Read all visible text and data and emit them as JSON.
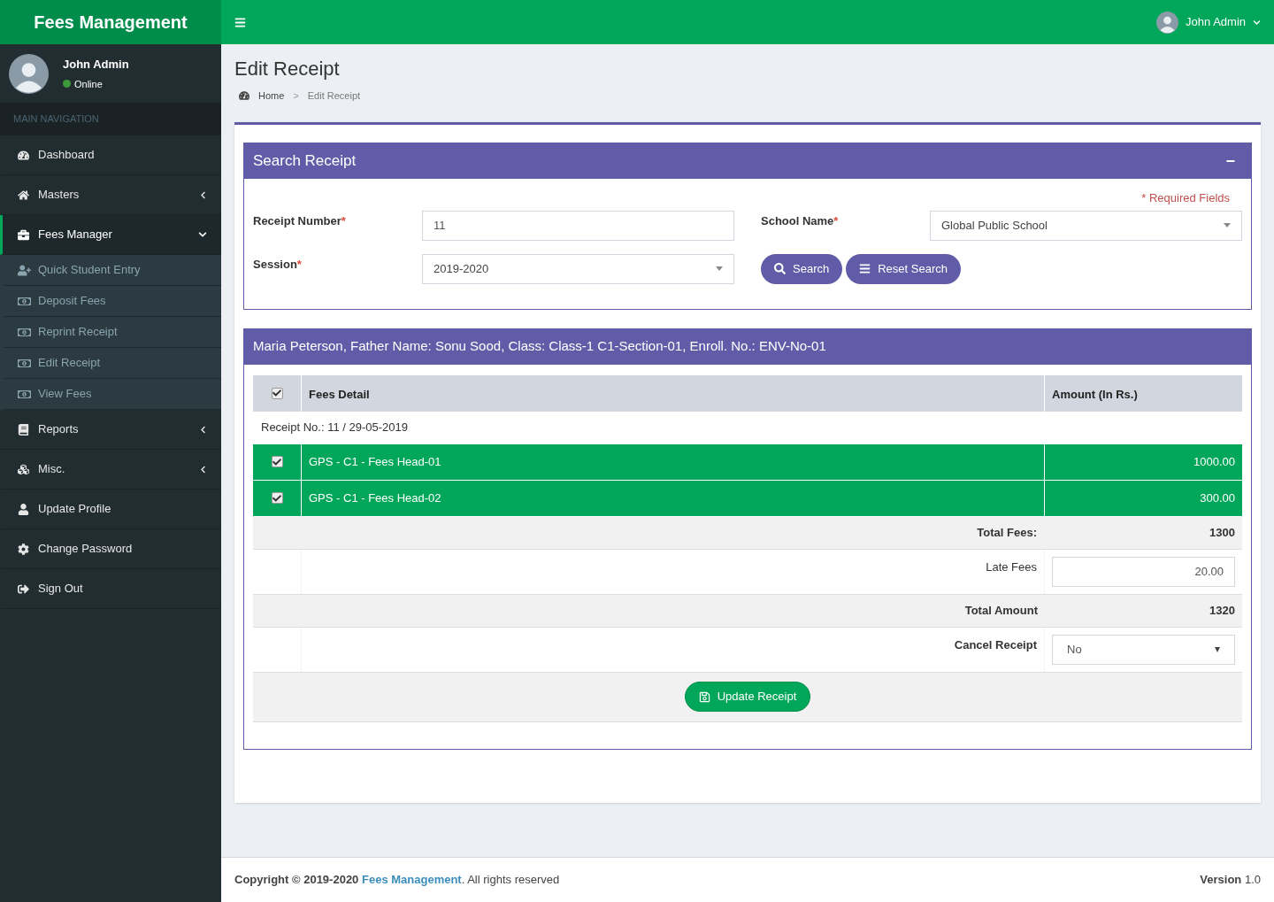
{
  "brand": "Fees Management",
  "topbar": {
    "user_name": "John Admin"
  },
  "sidebar": {
    "user": {
      "name": "John Admin",
      "status": "Online",
      "online": true
    },
    "nav_header": "MAIN NAVIGATION",
    "items": [
      {
        "label": "Dashboard",
        "selected": false
      },
      {
        "label": "Masters",
        "selected": false,
        "expanded": false
      },
      {
        "label": "Fees Manager",
        "selected": true,
        "expanded": true,
        "children": [
          {
            "label": "Quick Student Entry",
            "selected": false
          },
          {
            "label": "Deposit Fees",
            "selected": false
          },
          {
            "label": "Reprint Receipt",
            "selected": false
          },
          {
            "label": "Edit Receipt",
            "selected": false
          },
          {
            "label": "View Fees",
            "selected": false
          }
        ]
      },
      {
        "label": "Reports",
        "selected": false,
        "expanded": false
      },
      {
        "label": "Misc.",
        "selected": false,
        "expanded": false
      },
      {
        "label": "Update Profile",
        "selected": false
      },
      {
        "label": "Change Password",
        "selected": false
      },
      {
        "label": "Sign Out",
        "selected": false
      }
    ]
  },
  "page": {
    "title": "Edit Receipt",
    "breadcrumb": [
      "Home",
      "Edit Receipt"
    ],
    "breadcrumb_separator": ">"
  },
  "search_panel": {
    "title": "Search Receipt",
    "collapse": "−",
    "required_note": "* Required Fields",
    "fields": [
      {
        "label": "Receipt Number",
        "required_mark": "*",
        "kind": "input",
        "value": "11"
      },
      {
        "label": "School Name",
        "required_mark": "*",
        "kind": "select",
        "value": "Global Public School"
      },
      {
        "label": "Session",
        "required_mark": "*",
        "kind": "select",
        "value": "2019-2020"
      }
    ],
    "buttons": [
      "Search",
      "Reset Search"
    ]
  },
  "student_panel": {
    "title": "Maria Peterson, Father Name: Sonu Sood, Class: Class-1 C1-Section-01, Enroll. No.: ENV-No-01",
    "table": {
      "all_checked": true,
      "columns": [
        "Fees Detail",
        "Amount (In Rs.)"
      ],
      "receipt_info": "Receipt No.: 11 / 29-05-2019",
      "rows": [
        {
          "detail": "GPS - C1 - Fees Head-01",
          "amount": "1000.00",
          "checked": true
        },
        {
          "detail": "GPS - C1 - Fees Head-02",
          "amount": "300.00",
          "checked": true
        }
      ],
      "total_fees": {
        "label": "Total Fees:",
        "value": "1300"
      },
      "late_fees": {
        "label": "Late Fees",
        "value": "20.00"
      },
      "total_amount": {
        "label": "Total Amount",
        "value": "1320"
      },
      "cancel_receipt": {
        "label": "Cancel Receipt",
        "value": "No"
      },
      "update_button": "Update Receipt"
    }
  },
  "footer": {
    "copyright_prefix": "Copyright © 2019-2020",
    "link": "Fees Management",
    "copyright_suffix": ". All rights reserved",
    "version": "**Version** 1.0"
  }
}
